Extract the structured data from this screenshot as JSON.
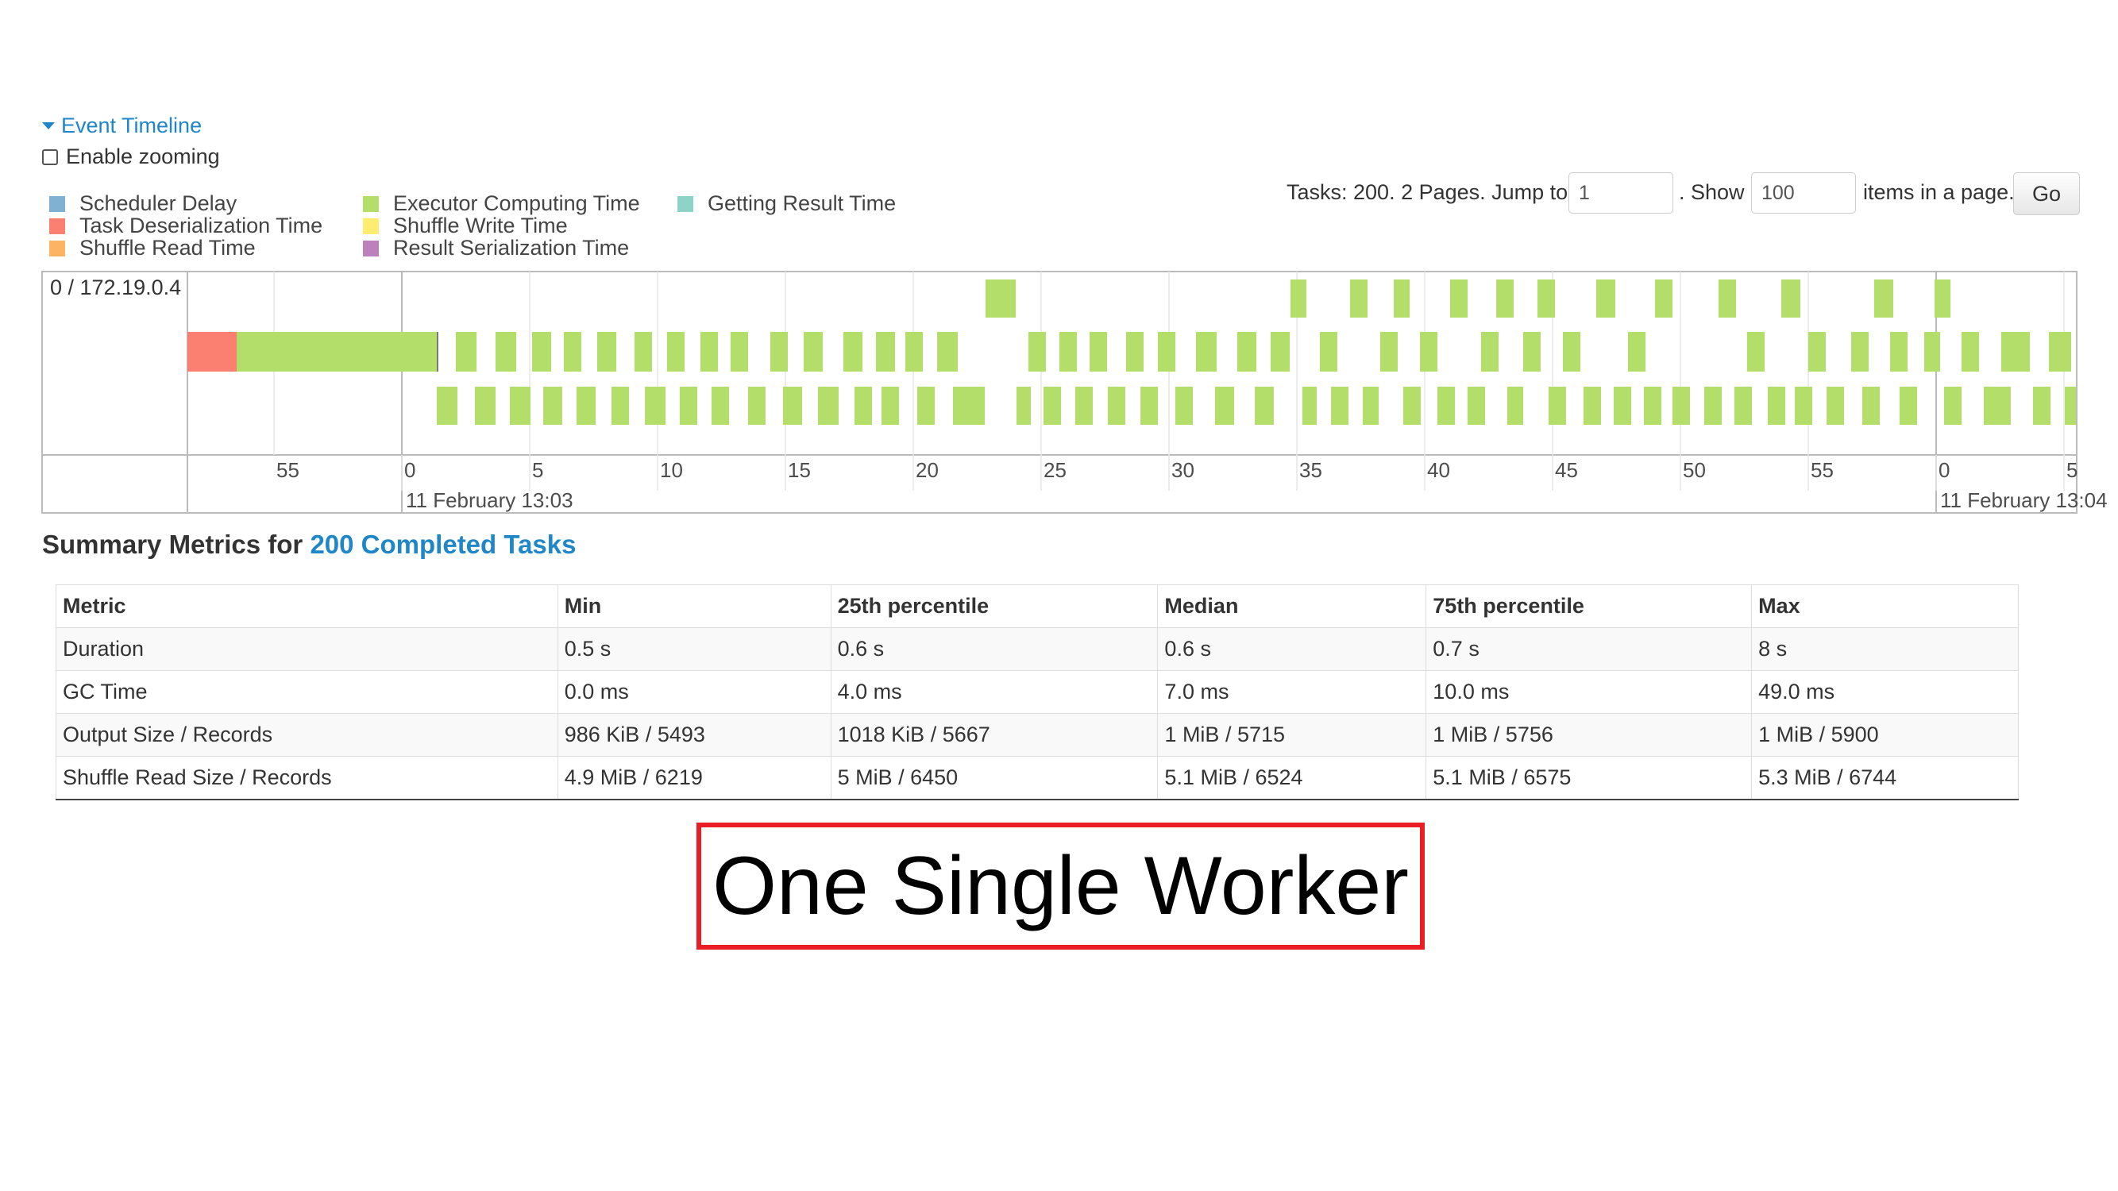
{
  "event_timeline": {
    "toggle_label": "Event Timeline",
    "enable_zooming_label": "Enable zooming",
    "legend": [
      {
        "label": "Scheduler Delay",
        "color": "#80b1d3"
      },
      {
        "label": "Task Deserialization Time",
        "color": "#fb8072"
      },
      {
        "label": "Shuffle Read Time",
        "color": "#fdb462"
      },
      {
        "label": "Executor Computing Time",
        "color": "#b3de69"
      },
      {
        "label": "Shuffle Write Time",
        "color": "#ffed6f"
      },
      {
        "label": "Result Serialization Time",
        "color": "#bc80bd"
      },
      {
        "label": "Getting Result Time",
        "color": "#8dd3c7"
      }
    ],
    "executor_label": "0 / 172.19.0.4",
    "x_ticks": [
      "55",
      "0",
      "5",
      "10",
      "15",
      "20",
      "25",
      "30",
      "35",
      "40",
      "45",
      "50",
      "55",
      "0",
      "5"
    ],
    "date_labels": [
      "11 February 13:03",
      "11 February 13:04"
    ],
    "deserialization_color": "#fb8072",
    "computing_color": "#b3de69"
  },
  "pager": {
    "tasks_text": "Tasks: 200. 2 Pages. Jump to",
    "page_value": "1",
    "show_text": ". Show",
    "page_size_value": "100",
    "items_text": "items in a page.",
    "go_label": "Go"
  },
  "summary": {
    "title_prefix": "Summary Metrics for",
    "title_link": "200 Completed Tasks",
    "columns": [
      "Metric",
      "Min",
      "25th percentile",
      "Median",
      "75th percentile",
      "Max"
    ],
    "rows": [
      [
        "Duration",
        "0.5 s",
        "0.6 s",
        "0.6 s",
        "0.7 s",
        "8 s"
      ],
      [
        "GC Time",
        "0.0 ms",
        "4.0 ms",
        "7.0 ms",
        "10.0 ms",
        "49.0 ms"
      ],
      [
        "Output Size / Records",
        "986 KiB / 5493",
        "1018 KiB / 5667",
        "1 MiB / 5715",
        "1 MiB / 5756",
        "1 MiB / 5900"
      ],
      [
        "Shuffle Read Size / Records",
        "4.9 MiB / 6219",
        "5 MiB / 6450",
        "5.1 MiB / 6524",
        "5.1 MiB / 6575",
        "5.3 MiB / 6744"
      ]
    ]
  },
  "caption": "One Single Worker"
}
